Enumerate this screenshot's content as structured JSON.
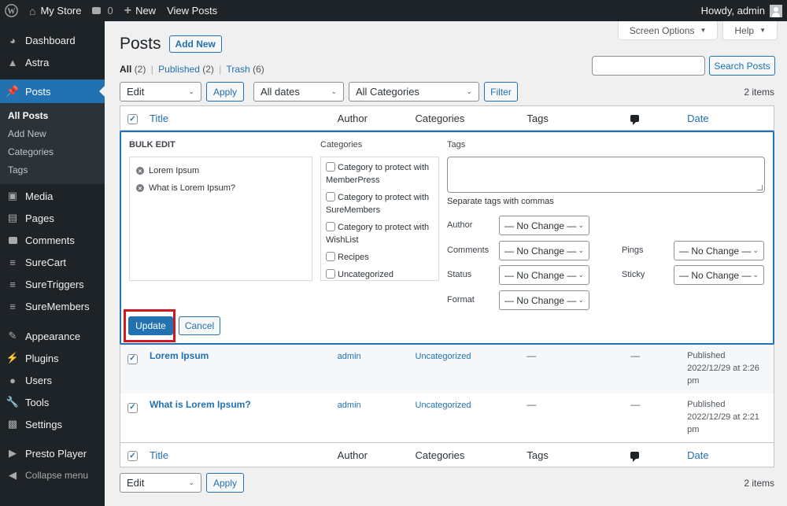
{
  "adminbar": {
    "site_name": "My Store",
    "comments_count": "0",
    "new_label": "New",
    "view_posts": "View Posts",
    "howdy": "Howdy, admin"
  },
  "sidebar": {
    "items": [
      {
        "label": "Dashboard",
        "icon": "dashboard-icon"
      },
      {
        "label": "Astra",
        "icon": "astra-icon"
      },
      {
        "label": "Posts",
        "icon": "pin-icon"
      },
      {
        "label": "Media",
        "icon": "media-icon"
      },
      {
        "label": "Pages",
        "icon": "pages-icon"
      },
      {
        "label": "Comments",
        "icon": "comment-icon"
      },
      {
        "label": "SureCart",
        "icon": "surecart-icon"
      },
      {
        "label": "SureTriggers",
        "icon": "suretriggers-icon"
      },
      {
        "label": "SureMembers",
        "icon": "suremembers-icon"
      },
      {
        "label": "Appearance",
        "icon": "brush-icon"
      },
      {
        "label": "Plugins",
        "icon": "plug-icon"
      },
      {
        "label": "Users",
        "icon": "user-icon"
      },
      {
        "label": "Tools",
        "icon": "wrench-icon"
      },
      {
        "label": "Settings",
        "icon": "settings-icon"
      },
      {
        "label": "Presto Player",
        "icon": "presto-icon"
      }
    ],
    "submenu": [
      "All Posts",
      "Add New",
      "Categories",
      "Tags"
    ],
    "collapse": "Collapse menu"
  },
  "header": {
    "title": "Posts",
    "add_new": "Add New",
    "screen_options": "Screen Options",
    "help": "Help"
  },
  "views": {
    "all": "All",
    "all_count": "(2)",
    "published": "Published",
    "published_count": "(2)",
    "trash": "Trash",
    "trash_count": "(6)",
    "sep": "|"
  },
  "search": {
    "value": "",
    "button": "Search Posts"
  },
  "tablenav_top": {
    "bulk_action": "Edit",
    "apply": "Apply",
    "dates": "All dates",
    "categories": "All Categories",
    "filter": "Filter",
    "items": "2 items"
  },
  "columns": {
    "title": "Title",
    "author": "Author",
    "categories": "Categories",
    "tags": "Tags",
    "date": "Date"
  },
  "bulk_edit": {
    "heading": "BULK EDIT",
    "posts": [
      "Lorem Ipsum",
      "What is Lorem Ipsum?"
    ],
    "categories_label": "Categories",
    "categories": [
      {
        "label": "Category to protect with MemberPress",
        "checked": false
      },
      {
        "label": "Category to protect with SureMembers",
        "checked": false
      },
      {
        "label": "Category to protect with WishList",
        "checked": false
      },
      {
        "label": "Recipes",
        "checked": false
      },
      {
        "label": "Uncategorized",
        "checked": false
      }
    ],
    "tags_label": "Tags",
    "tags_value": "",
    "tags_help": "Separate tags with commas",
    "fields": {
      "author": {
        "label": "Author",
        "value": "— No Change —"
      },
      "comments": {
        "label": "Comments",
        "value": "— No Change —"
      },
      "status": {
        "label": "Status",
        "value": "— No Change —"
      },
      "format": {
        "label": "Format",
        "value": "— No Change —"
      },
      "pings": {
        "label": "Pings",
        "value": "— No Change —"
      },
      "sticky": {
        "label": "Sticky",
        "value": "— No Change —"
      }
    },
    "update": "Update",
    "cancel": "Cancel"
  },
  "rows": [
    {
      "title": "Lorem Ipsum",
      "author": "admin",
      "categories": "Uncategorized",
      "tags": "—",
      "comments": "—",
      "status": "Published",
      "date": "2022/12/29 at 2:26 pm",
      "checked": true
    },
    {
      "title": "What is Lorem Ipsum?",
      "author": "admin",
      "categories": "Uncategorized",
      "tags": "—",
      "comments": "—",
      "status": "Published",
      "date": "2022/12/29 at 2:21 pm",
      "checked": true
    }
  ],
  "tablenav_bottom": {
    "bulk_action": "Edit",
    "apply": "Apply",
    "items": "2 items"
  },
  "colors": {
    "accent": "#2271b1",
    "adminbar": "#1d2327",
    "highlight": "#d0181e"
  }
}
